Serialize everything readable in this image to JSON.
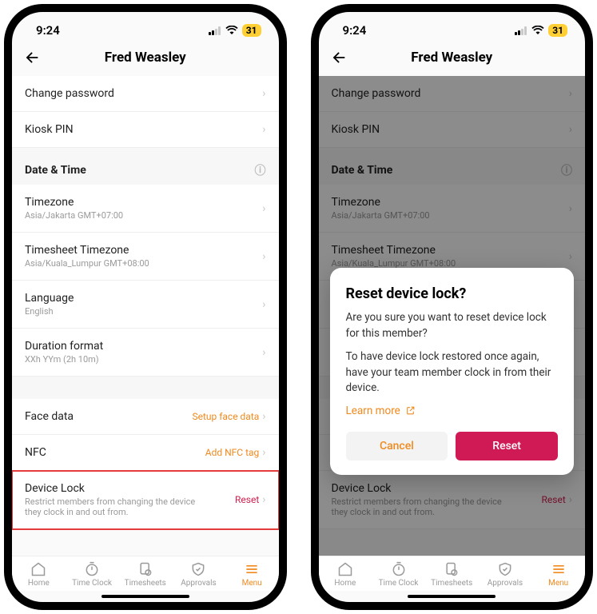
{
  "status": {
    "time": "9:24",
    "battery": "31"
  },
  "header": {
    "title": "Fred Weasley"
  },
  "rows": {
    "change_password": "Change password",
    "kiosk_pin": "Kiosk PIN",
    "date_time_section": "Date & Time",
    "timezone": {
      "label": "Timezone",
      "sub": "Asia/Jakarta GMT+07:00"
    },
    "ts_timezone": {
      "label": "Timesheet Timezone",
      "sub": "Asia/Kuala_Lumpur GMT+08:00"
    },
    "language": {
      "label": "Language",
      "sub": "English"
    },
    "duration": {
      "label": "Duration format",
      "sub": "XXh YYm (2h 10m)"
    },
    "face": {
      "label": "Face data",
      "action": "Setup face data"
    },
    "nfc": {
      "label": "NFC",
      "action": "Add NFC tag"
    },
    "device_lock": {
      "label": "Device Lock",
      "sub": "Restrict members from changing the device they clock in and out from.",
      "action": "Reset"
    }
  },
  "tabs": {
    "home": "Home",
    "timeclock": "Time Clock",
    "timesheets": "Timesheets",
    "approvals": "Approvals",
    "menu": "Menu"
  },
  "modal": {
    "title": "Reset device lock?",
    "p1": "Are you sure you want to reset device lock for this member?",
    "p2": "To have device lock restored once again, have your team member clock in from their device.",
    "learn": "Learn more",
    "cancel": "Cancel",
    "reset": "Reset"
  }
}
